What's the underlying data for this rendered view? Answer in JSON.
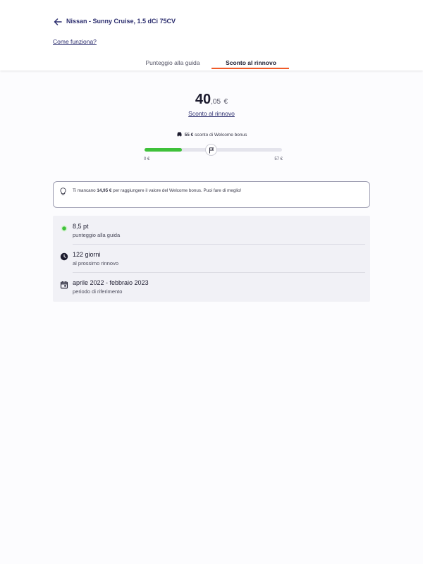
{
  "header": {
    "car_title": "Nissan - Sunny Cruise, 1.5 dCi 75CV",
    "how_link": "Come funziona?",
    "tabs": [
      {
        "label": "Punteggio alla guida",
        "active": false
      },
      {
        "label": "Sconto al rinnovo",
        "active": true
      }
    ]
  },
  "summary": {
    "amount_int": "40",
    "amount_dec": ",05",
    "currency": "€",
    "discount_link": "Sconto al rinnovo"
  },
  "bonus": {
    "amount": "55 €",
    "text": "sconto di Welcome bonus"
  },
  "progress": {
    "fraction": 0.27,
    "min_label": "0 €",
    "max_label": "57 €"
  },
  "tip": {
    "prefix": "Ti mancano",
    "amount": "14,95 €",
    "suffix": "per raggiungere il valore del Welcome bonus. Puoi fare di meglio!"
  },
  "stats": [
    {
      "icon": "green-dot-icon",
      "value": "8,5 pt",
      "label": "punteggio alla guida"
    },
    {
      "icon": "clock-icon",
      "value": "122 giorni",
      "label": "al prossimo rinnovo"
    },
    {
      "icon": "calendar-icon",
      "value": "aprile 2022 - febbraio 2023",
      "label": "periodo di riferimento"
    }
  ],
  "colors": {
    "accent": "#f05a28",
    "link": "#2b2d6e",
    "progress": "#3fc13a",
    "status_dot": "#3fc13a"
  }
}
